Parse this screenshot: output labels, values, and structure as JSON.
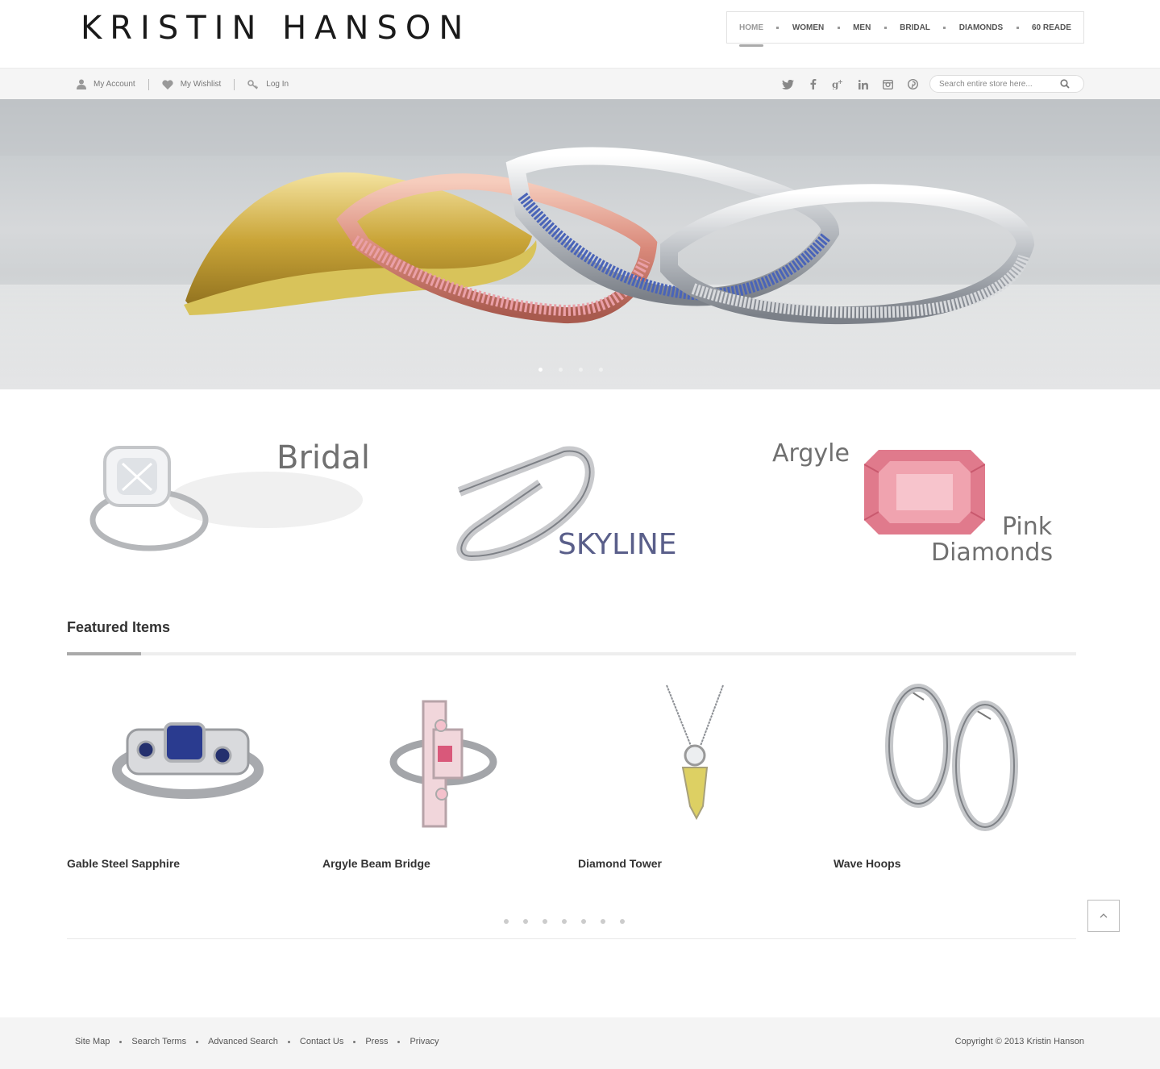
{
  "brand": {
    "logo": "KRISTIN HANSON"
  },
  "nav": {
    "items": [
      {
        "label": "HOME",
        "active": true
      },
      {
        "label": "WOMEN"
      },
      {
        "label": "MEN"
      },
      {
        "label": "BRIDAL"
      },
      {
        "label": "DIAMONDS"
      },
      {
        "label": "60 READE"
      }
    ]
  },
  "account": {
    "my_account": "My Account",
    "my_wishlist": "My Wishlist",
    "log_in": "Log In"
  },
  "social": {
    "icons": [
      "twitter-icon",
      "facebook-icon",
      "google-plus-icon",
      "linkedin-icon",
      "instagram-icon",
      "pinterest-icon"
    ]
  },
  "search": {
    "placeholder": "Search entire store here..."
  },
  "hero": {
    "slide_count": 4,
    "active_slide": 1
  },
  "promos": {
    "bridal": "Bridal",
    "skyline": "SKYLINE",
    "argyle_line1": "Argyle",
    "argyle_line2": "Pink",
    "argyle_line3": "Diamonds"
  },
  "featured": {
    "title": "Featured Items",
    "products": [
      {
        "name": "Gable Steel Sapphire"
      },
      {
        "name": "Argyle Beam Bridge"
      },
      {
        "name": "Diamond Tower"
      },
      {
        "name": "Wave Hoops"
      }
    ],
    "page_count": 7
  },
  "footer": {
    "links": [
      "Site Map",
      "Search Terms",
      "Advanced Search",
      "Contact Us",
      "Press",
      "Privacy"
    ],
    "copyright": "Copyright © 2013 Kristin Hanson"
  },
  "colors": {
    "accent": "#a9a9a9",
    "text": "#333333",
    "topbar": "#f5f5f5",
    "footer": "#f4f4f4"
  }
}
